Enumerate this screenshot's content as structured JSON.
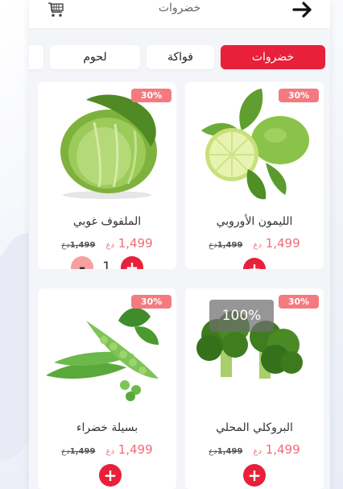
{
  "header": {
    "title": "خضروات",
    "cart_icon": "cart-icon",
    "back_icon": "arrow-right-icon"
  },
  "tabs": [
    {
      "label": "خضروات",
      "active": true
    },
    {
      "label": "فواكة",
      "active": false
    },
    {
      "label": "لحوم",
      "active": false
    },
    {
      "label": "",
      "active": false
    }
  ],
  "products": [
    {
      "name": "الليمون الأوروبي",
      "price": "1,499",
      "currency": "دع",
      "old_price": "1,499",
      "old_currency": "دع",
      "discount": "30%",
      "quantity": null
    },
    {
      "name": "الملفوف غوبي",
      "price": "1,499",
      "currency": "دع",
      "old_price": "1,499",
      "old_currency": "دع",
      "discount": "30%",
      "quantity": "1"
    },
    {
      "name": "البروكلي المحلي",
      "price": "1,499",
      "currency": "دع",
      "old_price": "1,499",
      "old_currency": "دع",
      "discount": "30%",
      "quantity": null
    },
    {
      "name": "بسيلة خضراء",
      "price": "1,499",
      "currency": "دع",
      "old_price": "1,499",
      "old_currency": "دع",
      "discount": "30%",
      "quantity": null
    }
  ],
  "loader": {
    "text": "100%"
  },
  "colors": {
    "accent": "#e8203a",
    "discount_badge": "#f47a80",
    "price": "#f26b75"
  }
}
